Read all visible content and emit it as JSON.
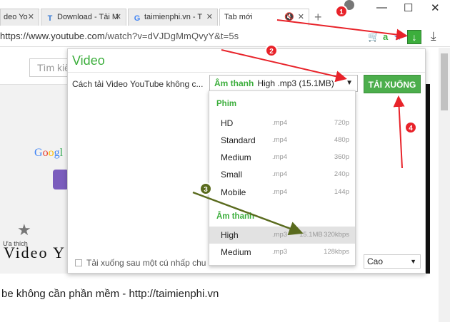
{
  "browser": {
    "tabs": [
      {
        "label": "deo Yo",
        "icon": "youtube-icon"
      },
      {
        "label": "Download - Tải M",
        "icon": "t-icon"
      },
      {
        "label": "taimienphi.vn - T",
        "icon": "google-icon"
      },
      {
        "label": "Tab mới",
        "icon": ""
      }
    ],
    "url_main": "https://www.youtube.com",
    "url_rest": "/watch?v=dVJDgMmQvyY&t=5s"
  },
  "page": {
    "search_placeholder": "Tìm kiế",
    "google_logo": "Googl",
    "favorites_label": "Ưa thích",
    "video_banner": "Video Y",
    "bottom_text": "be không cần phần mềm - http://taimienphi.vn"
  },
  "popup": {
    "title": "Video",
    "video_name": "Cách tải Video YouTube không c...",
    "selected_group": "Âm thanh",
    "selected_value": "High .mp3 (15.1MB)",
    "download_label": "TẢI XUỐNG",
    "auto_download_label": "Tải xuống sau một cú nhấp chu",
    "quality_value": "Cao",
    "groups": {
      "video_label": "Phim",
      "audio_label": "Âm thanh"
    },
    "video_options": [
      {
        "name": "HD",
        "ext": ".mp4",
        "quality": "720p"
      },
      {
        "name": "Standard",
        "ext": ".mp4",
        "quality": "480p"
      },
      {
        "name": "Medium",
        "ext": ".mp4",
        "quality": "360p"
      },
      {
        "name": "Small",
        "ext": ".mp4",
        "quality": "240p"
      },
      {
        "name": "Mobile",
        "ext": ".mp4",
        "quality": "144p"
      }
    ],
    "audio_options": [
      {
        "name": "High",
        "ext": ".mp3",
        "size": "15.1MB",
        "quality": "320kbps"
      },
      {
        "name": "Medium",
        "ext": ".mp3",
        "size": "",
        "quality": "128kbps"
      }
    ]
  },
  "annotations": {
    "badges": [
      "1",
      "2",
      "3",
      "4"
    ],
    "red": "#e8232a",
    "olive": "#5a6b1e"
  }
}
